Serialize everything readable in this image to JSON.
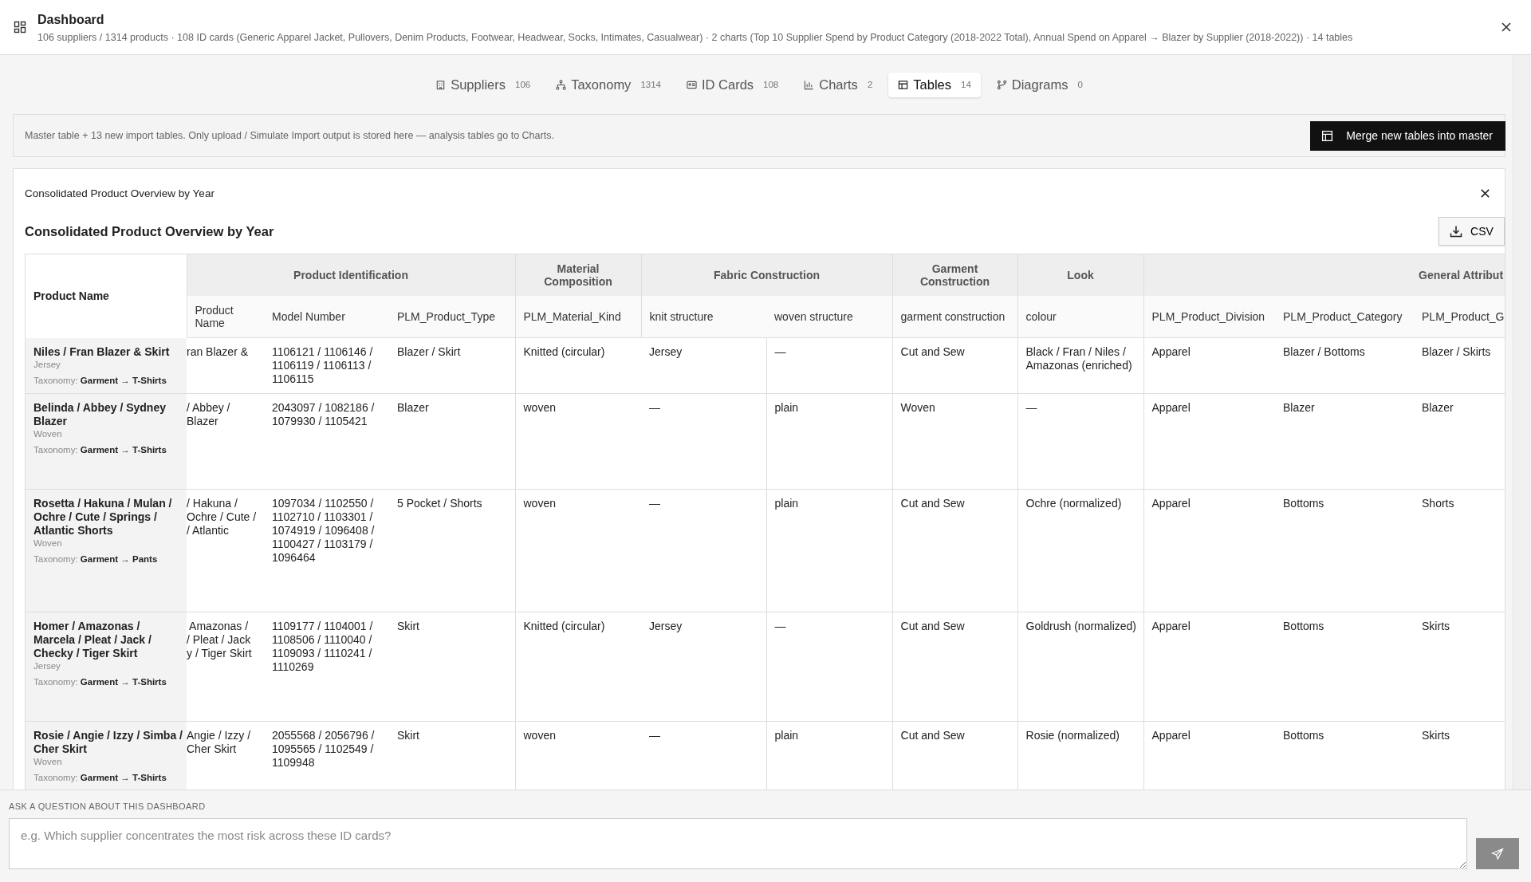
{
  "header": {
    "title": "Dashboard",
    "subtitle": "106 suppliers / 1314 products · 108 ID cards (Generic Apparel Jacket, Pullovers, Denim Products, Footwear, Headwear, Socks, Intimates, Casualwear) · 2 charts (Top 10 Supplier Spend by Product Category (2018-2022 Total), Annual Spend on Apparel → Blazer by Supplier (2018-2022)) · 14 tables"
  },
  "tabs": [
    {
      "label": "Suppliers",
      "count": "106",
      "selected": false
    },
    {
      "label": "Taxonomy",
      "count": "1314",
      "selected": false
    },
    {
      "label": "ID Cards",
      "count": "108",
      "selected": false
    },
    {
      "label": "Charts",
      "count": "2",
      "selected": false
    },
    {
      "label": "Tables",
      "count": "14",
      "selected": true
    },
    {
      "label": "Diagrams",
      "count": "0",
      "selected": false
    }
  ],
  "banner": {
    "text": "Master table + 13 new import tables. Only upload / Simulate Import output is stored here — analysis tables go to Charts.",
    "button": "Merge new tables into master"
  },
  "card": {
    "caption": "Consolidated Product Overview by Year",
    "title": "Consolidated Product Overview by Year",
    "csv_button": "CSV"
  },
  "table": {
    "first_header": "Product Name",
    "groups": [
      {
        "label": "Product Identification",
        "columns": [
          "Product Name",
          "Model Number",
          "PLM_Product_Type"
        ]
      },
      {
        "label": "Material Composition",
        "columns": [
          "PLM_Material_Kind"
        ]
      },
      {
        "label": "Fabric Construction",
        "columns": [
          "knit structure",
          "woven structure"
        ]
      },
      {
        "label": "Garment Construction",
        "columns": [
          "garment construction"
        ]
      },
      {
        "label": "Look",
        "columns": [
          "colour"
        ]
      },
      {
        "label": "General Attribut",
        "columns": [
          "PLM_Product_Division",
          "PLM_Product_Category",
          "PLM_Product_G"
        ]
      }
    ],
    "rows": [
      {
        "name": "Niles / Fran Blazer & Skirt",
        "fabric": "Jersey",
        "taxonomy": "Taxonomy: **Garment → T-Shirts**",
        "cells": [
          "ran Blazer &",
          "1106121 / 1106146 / 1106119 / 1106113 / 1106115",
          "Blazer / Skirt",
          "Knitted (circular)",
          "Jersey",
          "—",
          "Cut and Sew",
          "Black / Fran / Niles / Amazonas (enriched)",
          "Apparel",
          "Blazer / Bottoms",
          "Blazer / Skirts"
        ]
      },
      {
        "name": "Belinda / Abbey / Sydney Blazer",
        "fabric": "Woven",
        "taxonomy": "Taxonomy: **Garment → T-Shirts**",
        "cells": [
          "/ Abbey /\nBlazer",
          "2043097 / 1082186 / 1079930 / 1105421",
          "Blazer",
          "woven",
          "—",
          "plain",
          "Woven",
          "—",
          "Apparel",
          "Blazer",
          "Blazer"
        ]
      },
      {
        "name": "Rosetta / Hakuna / Mulan / Ochre / Cute / Springs / Atlantic Shorts",
        "fabric": "Woven",
        "taxonomy": "Taxonomy: **Garment → Pants**",
        "cells": [
          "/ Hakuna /\nOchre / Cute /\n/ Atlantic",
          "1097034 / 1102550 / 1102710 / 1103301 / 1074919 / 1096408 / 1100427 / 1103179 / 1096464",
          "5 Pocket / Shorts",
          "woven",
          "—",
          "plain",
          "Cut and Sew",
          "Ochre (normalized)",
          "Apparel",
          "Bottoms",
          "Shorts"
        ]
      },
      {
        "name": "Homer / Amazonas / Marcela / Pleat / Jack / Checky / Tiger Skirt",
        "fabric": "Jersey",
        "taxonomy": "Taxonomy: **Garment → T-Shirts**",
        "cells": [
          " Amazonas /\n/ Pleat / Jack\ny / Tiger Skirt",
          "1109177 / 1104001 / 1108506 / 1110040 / 1109093 / 1110241 / 1110269",
          "Skirt",
          "Knitted (circular)",
          "Jersey",
          "—",
          "Cut and Sew",
          "Goldrush (normalized)",
          "Apparel",
          "Bottoms",
          "Skirts"
        ]
      },
      {
        "name": "Rosie / Angie / Izzy / Simba / Cher Skirt",
        "fabric": "Woven",
        "taxonomy": "Taxonomy: **Garment → T-Shirts**",
        "cells": [
          "Angie / Izzy /\nCher Skirt",
          "2055568 / 2056796 / 1095565 / 1102549 / 1109948",
          "Skirt",
          "woven",
          "—",
          "plain",
          "Cut and Sew",
          "Rosie (normalized)",
          "Apparel",
          "Bottoms",
          "Skirts"
        ]
      }
    ]
  },
  "ask": {
    "label": "ASK A QUESTION ABOUT THIS DASHBOARD",
    "placeholder": "e.g. Which supplier concentrates the most risk across these ID cards?",
    "send_disabled": true
  }
}
